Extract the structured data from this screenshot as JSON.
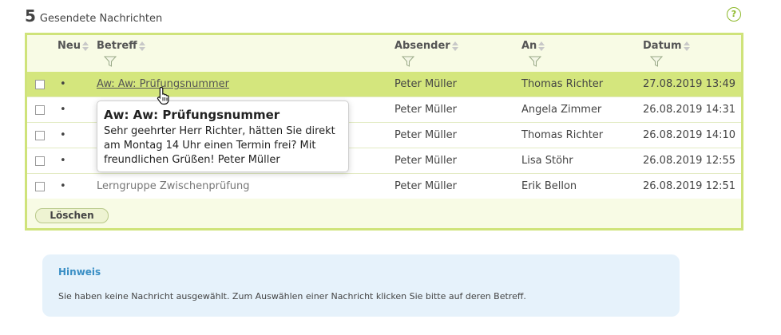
{
  "header": {
    "count": "5",
    "title": "Gesendete Nachrichten",
    "help_icon": "?"
  },
  "table": {
    "columns": {
      "new": "Neu",
      "subject": "Betreff",
      "sender": "Absender",
      "to": "An",
      "date": "Datum"
    },
    "rows": [
      {
        "dot": "•",
        "subject": "Aw: Aw: Prüfungsnummer",
        "sender": "Peter Müller",
        "to": "Thomas Richter",
        "date": "27.08.2019 13:49"
      },
      {
        "dot": "•",
        "subject": "",
        "sender": "Peter Müller",
        "to": "Angela Zimmer",
        "date": "26.08.2019 14:31"
      },
      {
        "dot": "•",
        "subject": "",
        "sender": "Peter Müller",
        "to": "Thomas Richter",
        "date": "26.08.2019 14:10"
      },
      {
        "dot": "•",
        "subject": "",
        "sender": "Peter Müller",
        "to": "Lisa Stöhr",
        "date": "26.08.2019 12:55"
      },
      {
        "dot": "•",
        "subject": "Lerngruppe Zwischenprüfung",
        "sender": "Peter Müller",
        "to": "Erik Bellon",
        "date": "26.08.2019 12:51"
      }
    ],
    "delete_label": "Löschen"
  },
  "tooltip": {
    "title": "Aw: Aw: Prüfungsnummer",
    "body": "Sehr geehrter Herr Richter, hätten Sie direkt am Montag 14 Uhr einen Termin frei? Mit freundlichen Grüßen! Peter Müller"
  },
  "notice": {
    "title": "Hinweis",
    "text": "Sie haben keine Nachricht ausgewählt. Zum Auswählen einer Nachricht klicken Sie bitte auf deren Betreff."
  },
  "colors": {
    "accent": "#cfe37a",
    "selected_row": "#d4e67d",
    "notice_bg": "#e6f2fb",
    "notice_title": "#3a8fc5"
  }
}
